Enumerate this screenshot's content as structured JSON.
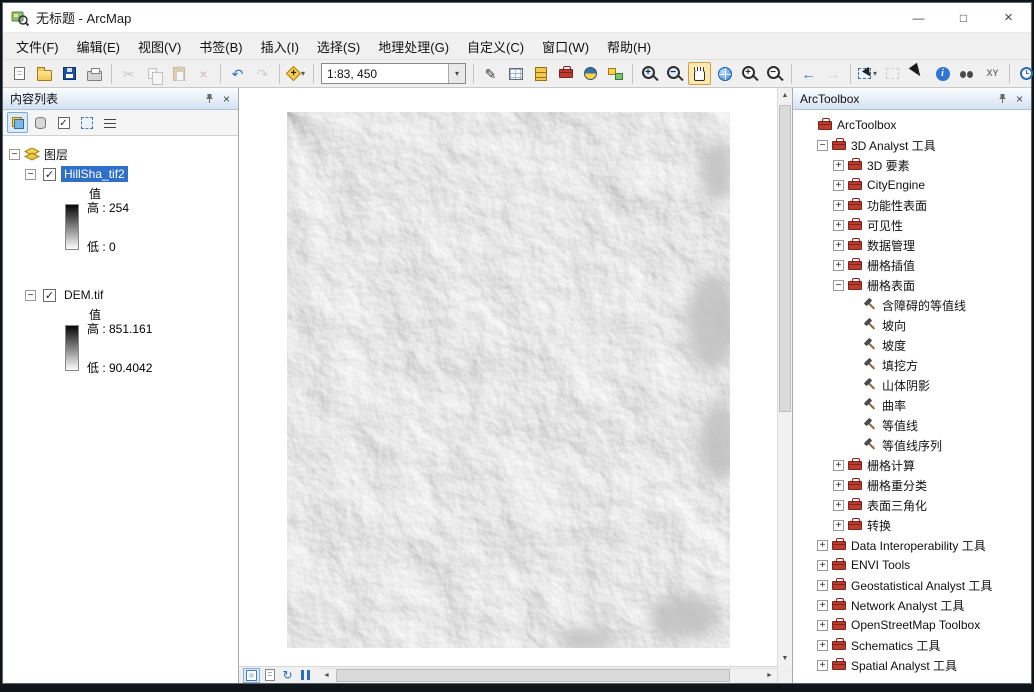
{
  "window": {
    "title": "无标题 - ArcMap"
  },
  "ui": {
    "minimize": "—",
    "maximize": "□",
    "close": "×",
    "scroll_up": "▲",
    "scroll_down": "▼",
    "scroll_left": "◄",
    "scroll_right": "►",
    "dropdown": "▾",
    "check": "✓",
    "collapse": "−",
    "expand": "+"
  },
  "menu": {
    "items": [
      {
        "name": "file",
        "label": "文件(F)"
      },
      {
        "name": "edit",
        "label": "编辑(E)"
      },
      {
        "name": "view",
        "label": "视图(V)"
      },
      {
        "name": "bookmarks",
        "label": "书签(B)"
      },
      {
        "name": "insert",
        "label": "插入(I)"
      },
      {
        "name": "selection",
        "label": "选择(S)"
      },
      {
        "name": "geoprocessing",
        "label": "地理处理(G)"
      },
      {
        "name": "customize",
        "label": "自定义(C)"
      },
      {
        "name": "window",
        "label": "窗口(W)"
      },
      {
        "name": "help",
        "label": "帮助(H)"
      }
    ]
  },
  "toolbar": {
    "scale_value": "1:83, 450",
    "items": [
      {
        "type": "icon",
        "name": "new-document",
        "cls": "ic-doc"
      },
      {
        "type": "icon",
        "name": "open-document",
        "cls": "ic-folder"
      },
      {
        "type": "icon",
        "name": "save-document",
        "cls": "ic-save"
      },
      {
        "type": "icon",
        "name": "print",
        "cls": "ic-print"
      },
      {
        "type": "sep"
      },
      {
        "type": "icon",
        "name": "cut",
        "glyph": "✂",
        "color": "#8a8a8a",
        "disabled": true
      },
      {
        "type": "icon",
        "name": "copy",
        "cls": "ic-copy",
        "disabled": true
      },
      {
        "type": "icon",
        "name": "paste",
        "cls": "ic-paste",
        "disabled": true
      },
      {
        "type": "icon",
        "name": "delete",
        "glyph": "×",
        "color": "#b05050",
        "disabled": true
      },
      {
        "type": "sep"
      },
      {
        "type": "icon",
        "name": "undo",
        "glyph": "↶",
        "color": "#2f6fd0"
      },
      {
        "type": "icon",
        "name": "redo",
        "glyph": "↷",
        "color": "#9a9a9a",
        "disabled": true
      },
      {
        "type": "sep"
      },
      {
        "type": "icon",
        "name": "add-data",
        "cls": "ic-adddata",
        "caret": true
      },
      {
        "type": "sep"
      },
      {
        "type": "combo",
        "name": "map-scale"
      },
      {
        "type": "sep"
      },
      {
        "type": "icon",
        "name": "editor-toolbar",
        "glyph": "✎",
        "color": "#3a3a3a"
      },
      {
        "type": "icon",
        "name": "table-of-contents-window",
        "cls": "ic-table"
      },
      {
        "type": "icon",
        "name": "catalog-window",
        "cls": "ic-catalog"
      },
      {
        "type": "icon",
        "name": "arctoolbox-window",
        "cls": "ic-toolboxred"
      },
      {
        "type": "icon",
        "name": "python-window",
        "cls": "ic-python"
      },
      {
        "type": "icon",
        "name": "modelbuilder-window",
        "cls": "ic-model"
      },
      {
        "type": "sep"
      },
      {
        "type": "icon",
        "name": "zoom-in",
        "cls": "ic-mag",
        "glyph": "+"
      },
      {
        "type": "icon",
        "name": "zoom-out",
        "cls": "ic-mag",
        "glyph": "−"
      },
      {
        "type": "icon",
        "name": "pan",
        "cls": "ic-hand",
        "active": true
      },
      {
        "type": "icon",
        "name": "full-extent",
        "cls": "ic-globe"
      },
      {
        "type": "icon",
        "name": "fixed-zoom-in",
        "cls": "ic-mag ic-mag-fixed",
        "glyph": "+"
      },
      {
        "type": "icon",
        "name": "fixed-zoom-out",
        "cls": "ic-mag ic-mag-fixed",
        "glyph": "−"
      },
      {
        "type": "sep"
      },
      {
        "type": "icon",
        "name": "go-back-to-previous-extent",
        "glyph": "←",
        "color": "#2f6fd0"
      },
      {
        "type": "icon",
        "name": "go-to-next-extent",
        "glyph": "→",
        "color": "#9a9a9a",
        "disabled": true
      },
      {
        "type": "sep"
      },
      {
        "type": "icon",
        "name": "select-features",
        "cls": "ic-selfeat",
        "caret": true
      },
      {
        "type": "icon",
        "name": "clear-selected-features",
        "cls": "ic-clearsel",
        "disabled": true
      },
      {
        "type": "icon",
        "name": "select-elements",
        "cls": "ic-cursor"
      },
      {
        "type": "icon",
        "name": "identify",
        "cls": "ic-identify"
      },
      {
        "type": "icon",
        "name": "find",
        "cls": "ic-find"
      },
      {
        "type": "icon",
        "name": "go-to-xy",
        "glyph": "XY",
        "color": "#777",
        "small": true
      },
      {
        "type": "sep"
      },
      {
        "type": "icon",
        "name": "time-slider",
        "cls": "ic-time"
      },
      {
        "type": "icon",
        "name": "create-viewer-window",
        "cls": "ic-viewer"
      }
    ]
  },
  "toc": {
    "title": "内容列表",
    "tools": [
      {
        "name": "list-by-drawing-order",
        "icon": "order",
        "active": true
      },
      {
        "name": "list-by-source",
        "icon": "source"
      },
      {
        "name": "list-by-visibility",
        "icon": "vis"
      },
      {
        "name": "list-by-selection",
        "icon": "sel"
      },
      {
        "name": "toc-options",
        "icon": "opt"
      }
    ],
    "root_label": "图层",
    "layers": [
      {
        "name": "HillSha_tif2",
        "checked": true,
        "selected": true,
        "value_label": "值",
        "high_label": "高 : 254",
        "low_label": "低 : 0"
      },
      {
        "name": "DEM.tif",
        "checked": true,
        "selected": false,
        "value_label": "值",
        "high_label": "高 : 851.161",
        "low_label": "低 : 90.4042"
      }
    ]
  },
  "map": {
    "view_buttons": [
      {
        "name": "data-view",
        "cls": "vic-data",
        "active": true
      },
      {
        "name": "layout-view",
        "cls": "vic-layout"
      },
      {
        "name": "refresh-view",
        "glyph": "↻",
        "color": "#2b6cb8"
      },
      {
        "name": "pause-drawing",
        "cls": "vic-pause"
      }
    ]
  },
  "toolbox": {
    "title": "ArcToolbox",
    "tree": [
      {
        "label": "ArcToolbox",
        "level": 0,
        "icon": "toolbox",
        "expander": "none"
      },
      {
        "label": "3D Analyst 工具",
        "level": 1,
        "icon": "toolbox",
        "expander": "minus"
      },
      {
        "label": "3D 要素",
        "level": 2,
        "icon": "toolbox",
        "expander": "plus"
      },
      {
        "label": "CityEngine",
        "level": 2,
        "icon": "toolbox",
        "expander": "plus"
      },
      {
        "label": "功能性表面",
        "level": 2,
        "icon": "toolbox",
        "expander": "plus"
      },
      {
        "label": "可见性",
        "level": 2,
        "icon": "toolbox",
        "expander": "plus"
      },
      {
        "label": "数据管理",
        "level": 2,
        "icon": "toolbox",
        "expander": "plus"
      },
      {
        "label": "栅格插值",
        "level": 2,
        "icon": "toolbox",
        "expander": "plus"
      },
      {
        "label": "栅格表面",
        "level": 2,
        "icon": "toolbox",
        "expander": "minus"
      },
      {
        "label": "含障碍的等值线",
        "level": 3,
        "icon": "tool",
        "expander": "none"
      },
      {
        "label": "坡向",
        "level": 3,
        "icon": "tool",
        "expander": "none"
      },
      {
        "label": "坡度",
        "level": 3,
        "icon": "tool",
        "expander": "none"
      },
      {
        "label": "填挖方",
        "level": 3,
        "icon": "tool",
        "expander": "none"
      },
      {
        "label": "山体阴影",
        "level": 3,
        "icon": "tool",
        "expander": "none"
      },
      {
        "label": "曲率",
        "level": 3,
        "icon": "tool",
        "expander": "none"
      },
      {
        "label": "等值线",
        "level": 3,
        "icon": "tool",
        "expander": "none"
      },
      {
        "label": "等值线序列",
        "level": 3,
        "icon": "tool",
        "expander": "none"
      },
      {
        "label": "栅格计算",
        "level": 2,
        "icon": "toolbox",
        "expander": "plus"
      },
      {
        "label": "栅格重分类",
        "level": 2,
        "icon": "toolbox",
        "expander": "plus"
      },
      {
        "label": "表面三角化",
        "level": 2,
        "icon": "toolbox",
        "expander": "plus"
      },
      {
        "label": "转换",
        "level": 2,
        "icon": "toolbox",
        "expander": "plus"
      },
      {
        "label": "Data Interoperability 工具",
        "level": 1,
        "icon": "toolbox",
        "expander": "plus"
      },
      {
        "label": "ENVI Tools",
        "level": 1,
        "icon": "toolbox",
        "expander": "plus"
      },
      {
        "label": "Geostatistical Analyst 工具",
        "level": 1,
        "icon": "toolbox",
        "expander": "plus"
      },
      {
        "label": "Network Analyst 工具",
        "level": 1,
        "icon": "toolbox",
        "expander": "plus"
      },
      {
        "label": "OpenStreetMap Toolbox",
        "level": 1,
        "icon": "toolbox",
        "expander": "plus"
      },
      {
        "label": "Schematics 工具",
        "level": 1,
        "icon": "toolbox",
        "expander": "plus"
      },
      {
        "label": "Spatial Analyst 工具",
        "level": 1,
        "icon": "toolbox",
        "expander": "plus"
      }
    ]
  }
}
